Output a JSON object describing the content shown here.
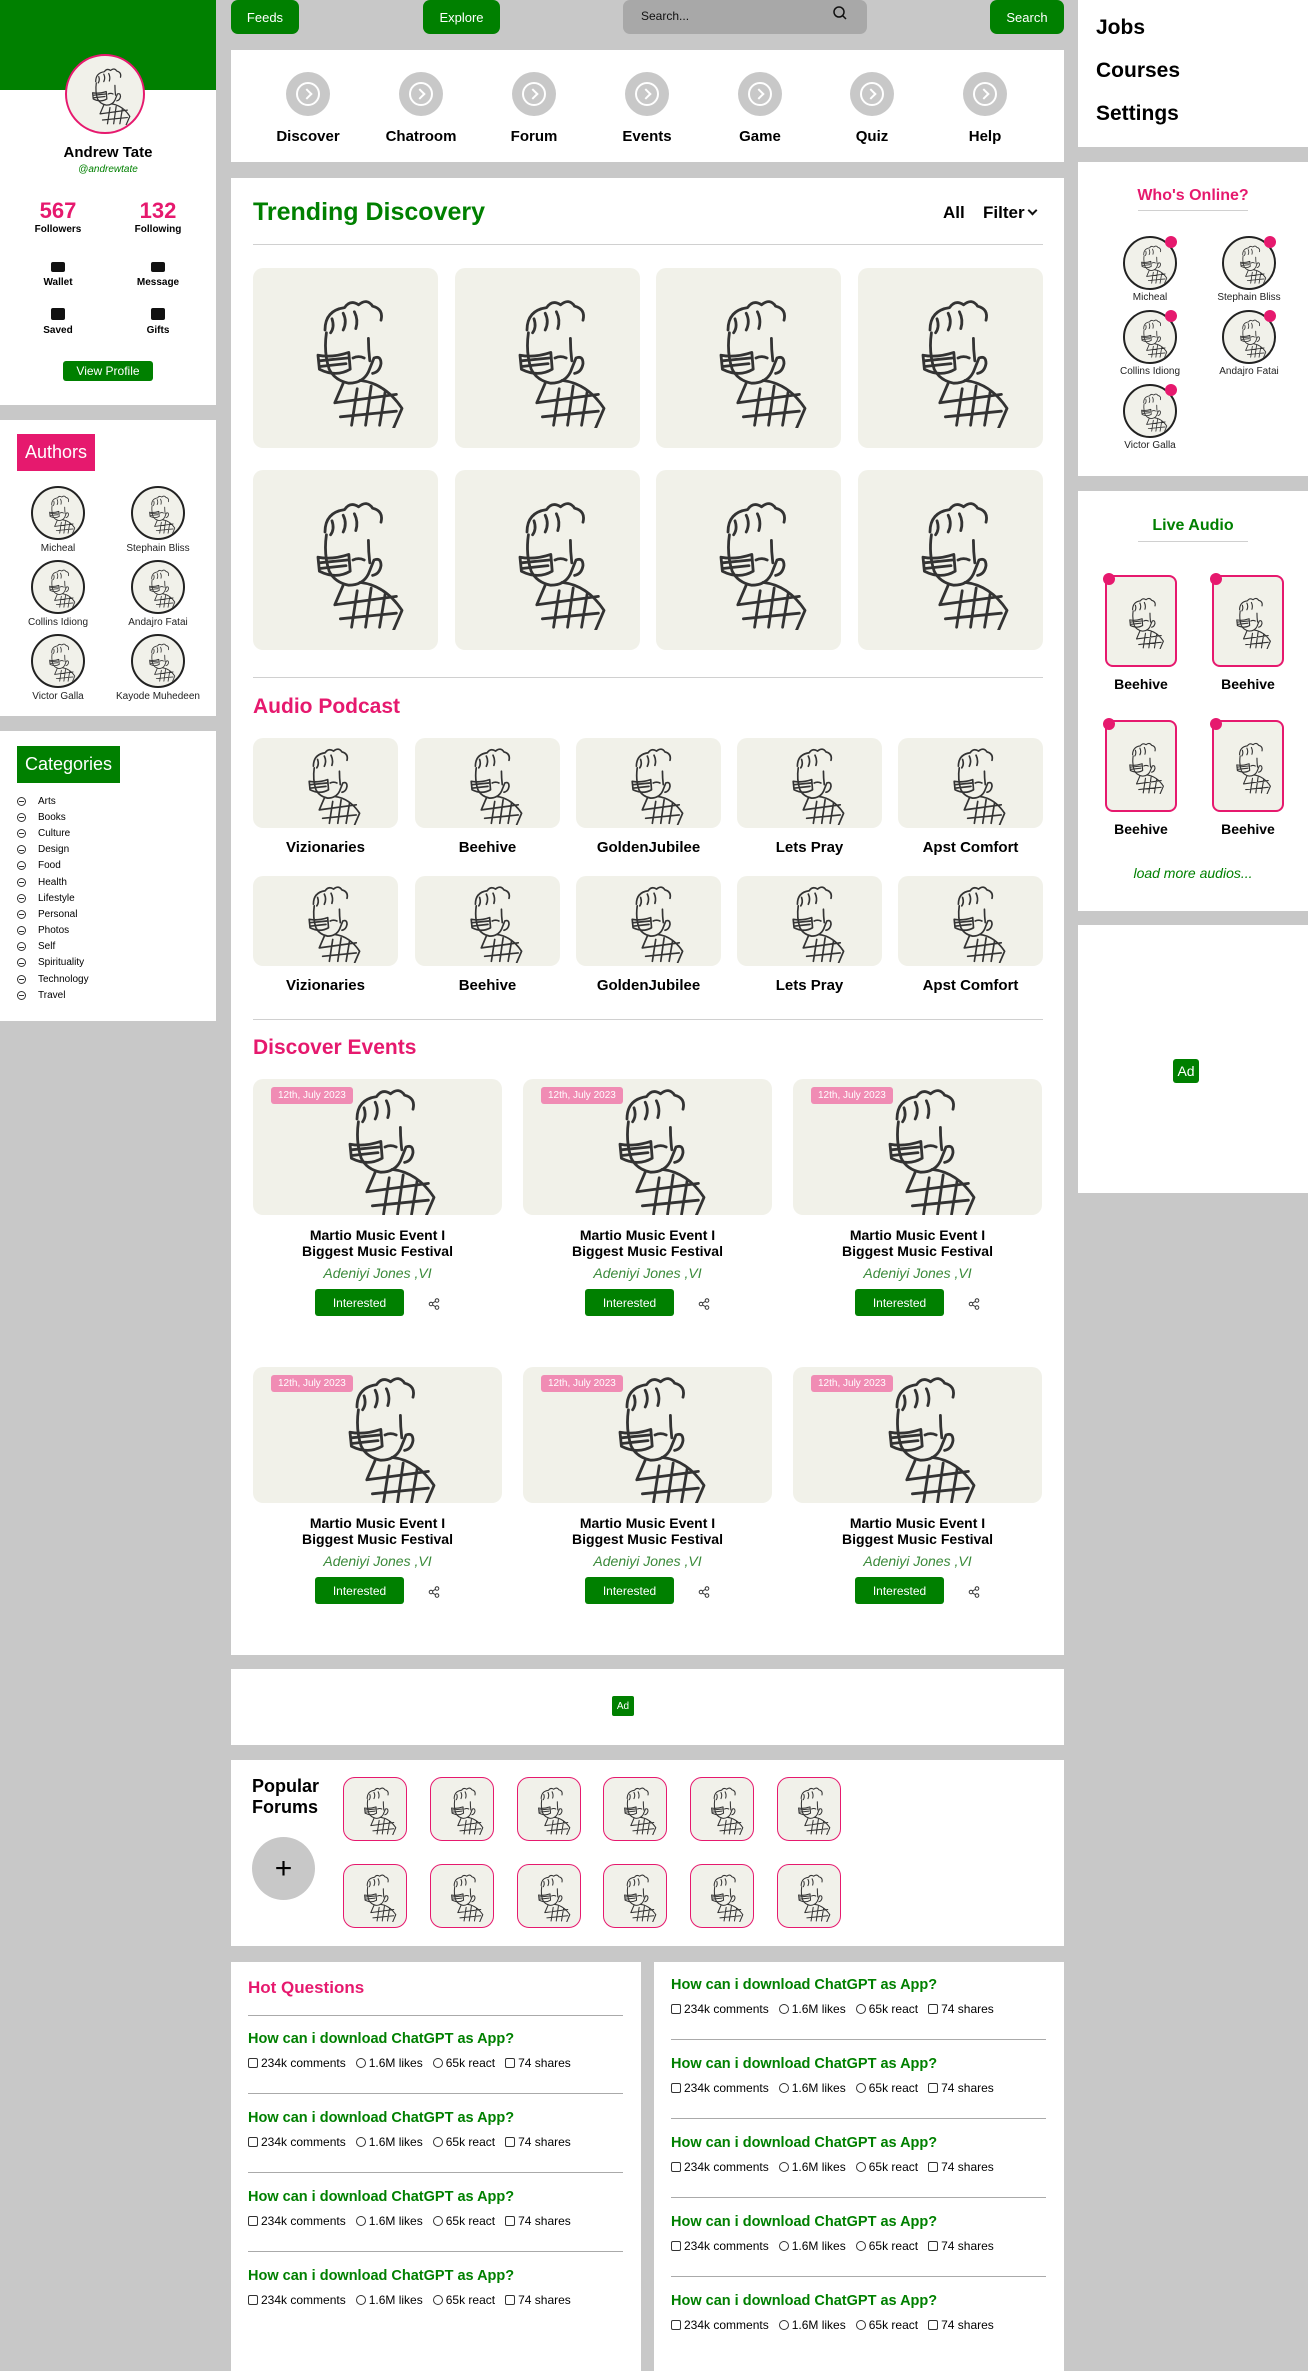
{
  "topbar": {
    "feeds": "Feeds",
    "explore": "Explore",
    "search_placeholder": "Search...",
    "search_btn": "Search"
  },
  "profile": {
    "name": "Andrew Tate",
    "handle": "@andrewtate",
    "followers": "567",
    "followers_label": "Followers",
    "following": "132",
    "following_label": "Following",
    "wallet": "Wallet",
    "message": "Message",
    "saved": "Saved",
    "gifts": "Gifts",
    "view_profile": "View Profile"
  },
  "authors": {
    "title": "Authors",
    "items": [
      "Micheal",
      "Stephain Bliss",
      "Collins Idiong",
      "Andajro Fatai",
      "Victor Galla",
      "Kayode Muhedeen"
    ]
  },
  "categories": {
    "title": "Categories",
    "items": [
      "Arts",
      "Books",
      "Culture",
      "Design",
      "Food",
      "Health",
      "Lifestyle",
      "Personal",
      "Photos",
      "Self",
      "Spirituality",
      "Technology",
      "Travel"
    ]
  },
  "nav": {
    "items": [
      "Discover",
      "Chatroom",
      "Forum",
      "Events",
      "Game",
      "Quiz",
      "Help"
    ]
  },
  "trending": {
    "title": "Trending Discovery",
    "all": "All",
    "filter": "Filter"
  },
  "podcast": {
    "title": "Audio Podcast",
    "row1": [
      "Vizionaries",
      "Beehive",
      "GoldenJubilee",
      "Lets Pray",
      "Apst Comfort"
    ],
    "row2": [
      "Vizionaries",
      "Beehive",
      "GoldenJubilee",
      "Lets Pray",
      "Apst Comfort"
    ]
  },
  "events": {
    "title": "Discover Events",
    "date": "12th, July 2023",
    "name_line1": "Martio Music Event I",
    "name_line2": "Biggest Music Festival",
    "host": "Adeniyi Jones ,VI",
    "btn": "Interested"
  },
  "ad": {
    "label": "Ad"
  },
  "forums": {
    "title_line1": "Popular",
    "title_line2": "Forums",
    "add": "+"
  },
  "questions": {
    "title": "Hot Questions",
    "q": "How can i download ChatGPT as App?",
    "comments": "234k comments",
    "likes": "1.6M likes",
    "react": "65k react",
    "shares": "74 shares"
  },
  "right_menu": {
    "items": [
      "Jobs",
      "Courses",
      "Settings"
    ]
  },
  "online": {
    "title": "Who's Online?",
    "items": [
      "Micheal",
      "Stephain Bliss",
      "Collins Idiong",
      "Andajro Fatai",
      "Victor Galla"
    ]
  },
  "live_audio": {
    "title": "Live Audio",
    "items": [
      "Beehive",
      "Beehive",
      "Beehive",
      "Beehive"
    ],
    "load_more": "load more audios..."
  },
  "colors": {
    "green": "#008000",
    "pink": "#e6196e",
    "bg": "#c8c8c8"
  }
}
